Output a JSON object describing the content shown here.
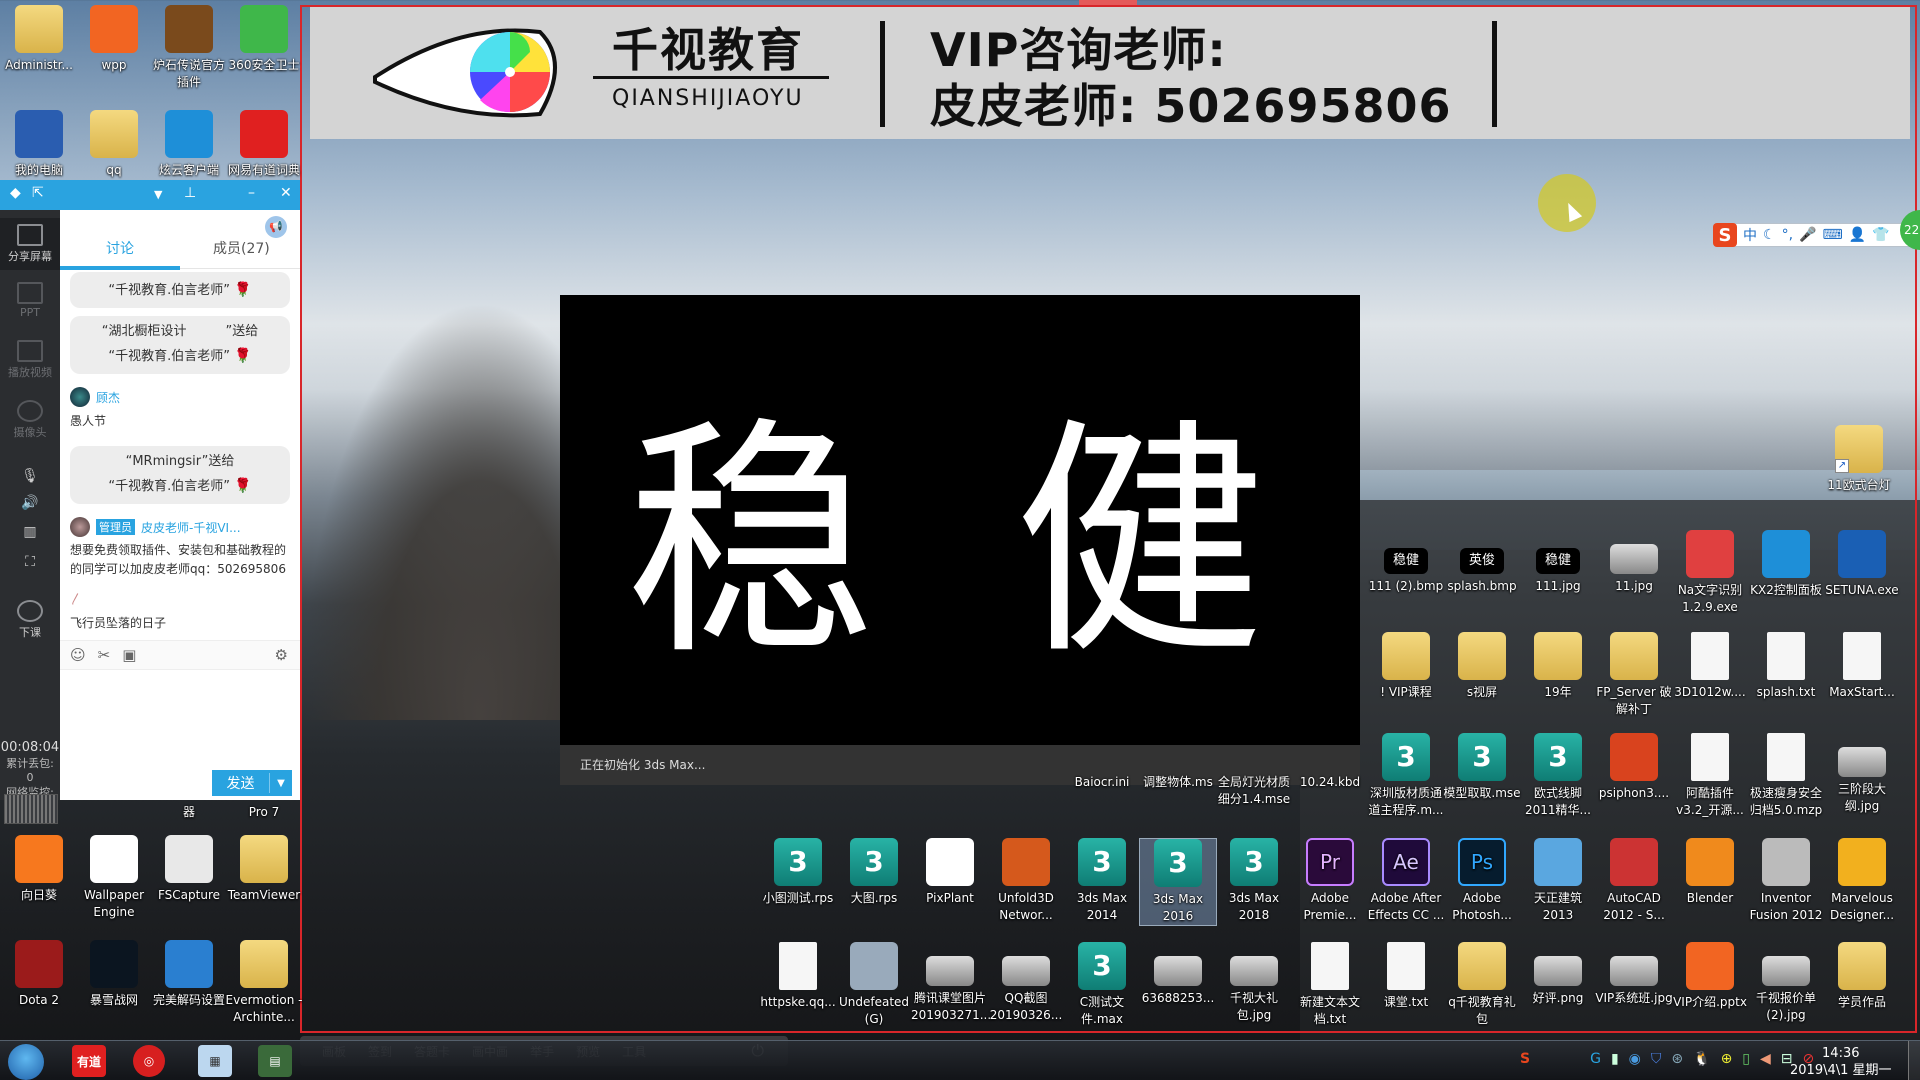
{
  "banner": {
    "brand_cn": "千视教育",
    "brand_en": "QIANSHIJIAOYU",
    "vip_line1": "VIP咨询老师:",
    "vip_line2": "皮皮老师: 502695806"
  },
  "ime": {
    "logo": "S",
    "mode": "中",
    "badge": "22",
    "items": [
      "中",
      "☾",
      "°,",
      "🎤",
      "⌨",
      "👤",
      "👕"
    ]
  },
  "splash": {
    "title": "稳 健",
    "status": "正在初始化 3ds Max..."
  },
  "qq_panel": {
    "side_items": [
      {
        "label": "分享屏幕",
        "icon": "share-screen-icon",
        "dim": false
      },
      {
        "label": "PPT",
        "icon": "ppt-icon",
        "dim": true
      },
      {
        "label": "播放视频",
        "icon": "play-video-icon",
        "dim": true
      },
      {
        "label": "摄像头",
        "icon": "camera-icon",
        "dim": true
      },
      {
        "label": "下课",
        "icon": "end-class-icon",
        "dim": false
      }
    ],
    "tabs": [
      {
        "label": "讨论",
        "active": true
      },
      {
        "label": "成员(27)",
        "active": false
      }
    ],
    "messages": {
      "gift1_line2": "“千视教育.伯言老师”",
      "gift2_line1": "“湖北橱柜设计　　　”送给",
      "gift2_line2": "“千视教育.伯言老师”",
      "user1_name": "顾杰",
      "user1_text": "愚人节",
      "gift3_line1": "“MRmingsir”送给",
      "gift3_line2": "“千视教育.伯言老师”",
      "admin_badge": "管理员",
      "admin_name": "皮皮老师-千视VI...",
      "admin_text": "想要免费领取插件、安装包和基础教程的的同学可以加皮皮老师qq：502695806",
      "user3_text": "飞行员坠落的日子"
    },
    "send_label": "发送",
    "timer": "00:08:04",
    "packet_loss_label": "累计丢包:",
    "packet_loss_value": "0",
    "network_label": "网络监控:"
  },
  "desktop_icons": [
    {
      "label": "Administr...",
      "type": "folder"
    },
    {
      "label": "wpp",
      "type": "app",
      "color": "#f26522"
    },
    {
      "label": "炉石传说官方插件",
      "type": "app",
      "color": "#7a4a1c"
    },
    {
      "label": "360安全卫士",
      "type": "app",
      "color": "#3fb74a"
    },
    {
      "label": "我的电脑",
      "type": "app",
      "color": "#2a5db0"
    },
    {
      "label": "qq",
      "type": "folder"
    },
    {
      "label": "炫云客户端",
      "type": "app",
      "color": "#1e8fd8"
    },
    {
      "label": "网易有道词典",
      "type": "app",
      "color": "#e02020"
    },
    {
      "label": "向日葵",
      "type": "app",
      "color": "#f7781e"
    },
    {
      "label": "Wallpaper Engine",
      "type": "app",
      "color": "#ffffff"
    },
    {
      "label": "FSCapture",
      "type": "app",
      "color": "#e8e8e8"
    },
    {
      "label": "TeamViewer",
      "type": "folder"
    },
    {
      "label": "Dota 2",
      "type": "app",
      "color": "#9b1b1b"
    },
    {
      "label": "暴雪战网",
      "type": "app",
      "color": "#0b1520"
    },
    {
      "label": "完美解码设置",
      "type": "app",
      "color": "#2a7fd0"
    },
    {
      "label": "Evermotion - Archinte...",
      "type": "folder"
    },
    {
      "label": "Pro 7",
      "type": "hidden"
    },
    {
      "label": "器",
      "type": "hidden"
    }
  ],
  "right_icons_row1": [
    {
      "label": "111 (2).bmp",
      "thumb": "稳健"
    },
    {
      "label": "splash.bmp",
      "thumb": "英俊"
    },
    {
      "label": "111.jpg",
      "thumb": "稳健"
    },
    {
      "label": "11.jpg",
      "thumb": ""
    },
    {
      "label": "Na文字识别1.2.9.exe",
      "thumb": ""
    },
    {
      "label": "KX2控制面板",
      "thumb": ""
    },
    {
      "label": "SETUNA.exe",
      "thumb": ""
    }
  ],
  "right_icons_row2": [
    {
      "label": "! VIP课程",
      "type": "folder"
    },
    {
      "label": "s视屏",
      "type": "folder"
    },
    {
      "label": "19年",
      "type": "folder"
    },
    {
      "label": "FP_Server 破解补丁",
      "type": "folder"
    },
    {
      "label": "3D1012w....",
      "type": "doc"
    },
    {
      "label": "splash.txt",
      "type": "doc"
    },
    {
      "label": "MaxStart...",
      "type": "doc"
    }
  ],
  "right_icons_row3": [
    {
      "label": "Baiocr.ini",
      "type": "none"
    },
    {
      "label": "调整物体.ms",
      "type": "none"
    },
    {
      "label": "全局灯光材质细分1.4.mse",
      "type": "none"
    },
    {
      "label": "10.24.kbd",
      "type": "none"
    },
    {
      "label": "深圳版材质通道主程序.m...",
      "type": "mse"
    },
    {
      "label": "模型取取.mse",
      "type": "mse"
    },
    {
      "label": "欧式线脚2011精华...",
      "type": "max"
    },
    {
      "label": "psiphon3....",
      "type": "app"
    },
    {
      "label": "阿酷插件v3.2_开源...",
      "type": "doc"
    },
    {
      "label": "极速瘦身安全归档5.0.mzp",
      "type": "doc"
    },
    {
      "label": "三阶段大纲.jpg",
      "type": "img"
    }
  ],
  "right_icons_row4": [
    {
      "label": "小图测试.rps",
      "type": "max"
    },
    {
      "label": "大图.rps",
      "type": "max"
    },
    {
      "label": "PixPlant",
      "type": "app"
    },
    {
      "label": "Unfold3D Networ...",
      "type": "app"
    },
    {
      "label": "3ds Max 2014",
      "type": "max"
    },
    {
      "label": "3ds Max 2016",
      "type": "max",
      "selected": true
    },
    {
      "label": "3ds Max 2018",
      "type": "max"
    },
    {
      "label": "Adobe Premie...",
      "type": "pr"
    },
    {
      "label": "Adobe After Effects CC ...",
      "type": "ae"
    },
    {
      "label": "Adobe Photosh...",
      "type": "ps"
    },
    {
      "label": "天正建筑2013",
      "type": "app"
    },
    {
      "label": "AutoCAD 2012 - S...",
      "type": "app"
    },
    {
      "label": "Blender",
      "type": "app"
    },
    {
      "label": "Inventor Fusion 2012",
      "type": "app"
    },
    {
      "label": "Marvelous Designer...",
      "type": "app"
    }
  ],
  "right_icons_row5": [
    {
      "label": "httpske.qq...",
      "type": "doc"
    },
    {
      "label": "Undefeated (G)",
      "type": "app"
    },
    {
      "label": "腾讯课堂图片201903271...",
      "type": "img"
    },
    {
      "label": "QQ截图20190326...",
      "type": "img"
    },
    {
      "label": "C测试文件.max",
      "type": "max"
    },
    {
      "label": "63688253...",
      "type": "img"
    },
    {
      "label": "千视大礼包.jpg",
      "type": "img"
    },
    {
      "label": "新建文本文档.txt",
      "type": "doc"
    },
    {
      "label": "课堂.txt",
      "type": "doc"
    },
    {
      "label": "q千视教育礼包",
      "type": "folder"
    },
    {
      "label": "好评.png",
      "type": "img"
    },
    {
      "label": "VIP系统班.jpg",
      "type": "img"
    },
    {
      "label": "VIP介绍.pptx",
      "type": "app"
    },
    {
      "label": "千视报价单(2).jpg",
      "type": "img"
    },
    {
      "label": "学员作品",
      "type": "folder"
    }
  ],
  "lamp_icon": {
    "label": "11欧式台灯"
  },
  "class_toolbar": [
    "画板",
    "签到",
    "答题卡",
    "画中画",
    "举手",
    "预览",
    "工具"
  ],
  "taskbar": {
    "pinned": [
      "start",
      "有道",
      "网易云音乐",
      "计算器",
      "任务管理器"
    ],
    "time": "14:36",
    "date": "2019\\4\\1 星期一"
  }
}
